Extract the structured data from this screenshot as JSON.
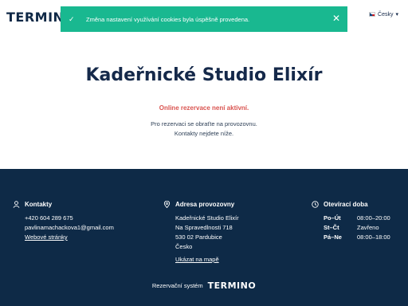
{
  "header": {
    "logo_text": "TERMINO",
    "language": "Česky"
  },
  "toast": {
    "message": "Změna nastavení využívání cookies byla úspěšně provedena.",
    "close_label": "✕",
    "check_glyph": "✓"
  },
  "main": {
    "title": "Kadeřnické Studio Elixír",
    "warning": "Online rezervace není aktivní.",
    "info_line1": "Pro rezervaci se obraťte na provozovnu.",
    "info_line2": "Kontakty nejdete níže."
  },
  "footer": {
    "contacts": {
      "heading": "Kontakty",
      "phone": "+420 604 289 675",
      "email": "pavlinamachackova1@gmail.com",
      "website": "Webové stránky"
    },
    "address": {
      "heading": "Adresa provozovny",
      "name": "Kadeřnické Studio Elixír",
      "street": "Na Spravedlnosti 718",
      "city": "530 02 Pardubice",
      "country": "Česko",
      "map_link": "Ukázat na mapě"
    },
    "hours": {
      "heading": "Otevírací doba",
      "rows": [
        {
          "days": "Po–Út",
          "time": "08:00–20:00"
        },
        {
          "days": "St–Čt",
          "time": "Zavřeno"
        },
        {
          "days": "Pá–Ne",
          "time": "08:00–18:00"
        }
      ]
    },
    "powered_by": "Rezervační systém",
    "brand": "TERMINO"
  },
  "colors": {
    "toast_bg": "#19b890",
    "footer_bg": "#0e2a47",
    "warning": "#d9534f",
    "title": "#15294a"
  }
}
